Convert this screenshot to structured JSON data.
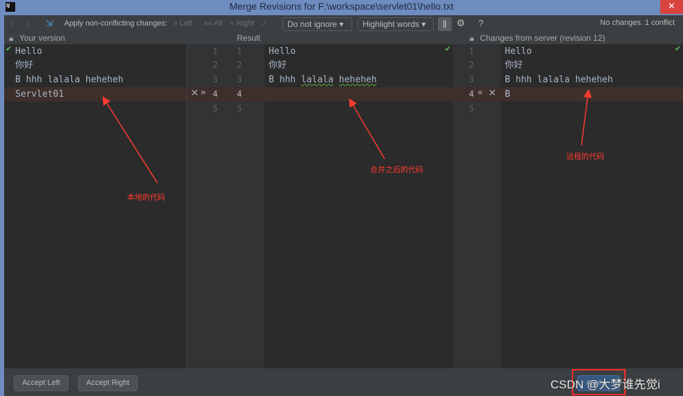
{
  "window": {
    "title": "Merge Revisions for F:\\workspace\\servlet01\\hello.txt",
    "logo": "IJ",
    "close": "✕"
  },
  "toolbar": {
    "apply_label": "Apply non-conflicting changes:",
    "left": "Left",
    "all": "All",
    "right": "Right",
    "ignore_combo": "Do not ignore",
    "highlight_combo": "Highlight words",
    "help": "?",
    "status": "No changes. 1 conflict"
  },
  "headers": {
    "left": "Your version",
    "center": "Result",
    "right": "Changes from server (revision 12)"
  },
  "left_lines": [
    "Hello",
    "你好",
    "B hhh lalala heheheh",
    "Servlet01"
  ],
  "result_lines": [
    "Hello",
    "你好",
    "B hhh ",
    "lalala",
    " ",
    "heheheh"
  ],
  "right_lines": [
    "Hello",
    "你好",
    "B hhh lalala heheheh",
    "B"
  ],
  "line_numbers": [
    "1",
    "2",
    "3",
    "4",
    "5"
  ],
  "annotations": {
    "local": "本地的代码",
    "merged": "合并之后的代码",
    "remote": "远程的代码",
    "color": "#ff3b30"
  },
  "buttons": {
    "accept_left": "Accept Left",
    "accept_right": "Accept Right",
    "apply": "Apply"
  },
  "watermark": "CSDN @大梦谁先觉i"
}
